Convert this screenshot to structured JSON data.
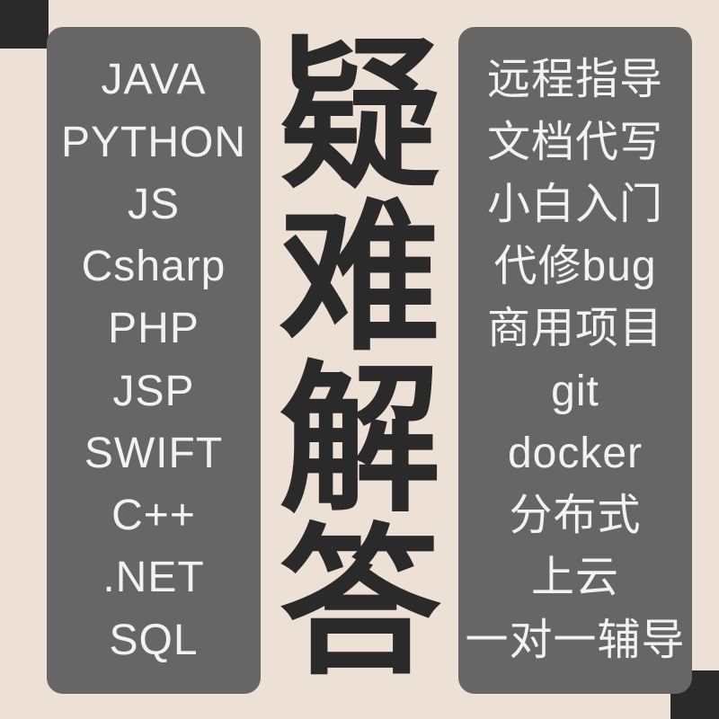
{
  "left_items": [
    "JAVA",
    "PYTHON",
    "JS",
    "Csharp",
    "PHP",
    "JSP",
    "SWIFT",
    "C++",
    ".NET",
    "SQL"
  ],
  "center_chars": [
    "疑",
    "难",
    "解",
    "答"
  ],
  "right_items": [
    "远程指导",
    "文档代写",
    "小白入门",
    "代修bug",
    "商用项目",
    "git",
    "docker",
    "分布式",
    "上云",
    "一对一辅导"
  ]
}
